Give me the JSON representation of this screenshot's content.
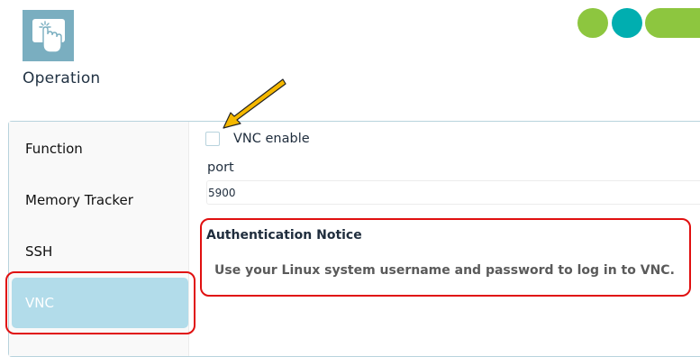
{
  "header": {
    "title": "Operation",
    "app_icon": "touch-hand-icon"
  },
  "colors": {
    "dot_1": "#8dc63f",
    "dot_2": "#00aeb0",
    "dot_3": "#8dc63f",
    "sidebar_active": "#b2dcea",
    "highlight": "#e01010",
    "arrow": "#f5b800"
  },
  "sidebar": {
    "items": [
      {
        "label": "Function"
      },
      {
        "label": "Memory Tracker"
      },
      {
        "label": "SSH"
      },
      {
        "label": "VNC",
        "active": true
      }
    ]
  },
  "vnc": {
    "enable_label": "VNC enable",
    "enabled": false,
    "port_label": "port",
    "port_value": "5900"
  },
  "notice": {
    "title": "Authentication Notice",
    "text": "Use your Linux system username and password to log in to VNC."
  }
}
